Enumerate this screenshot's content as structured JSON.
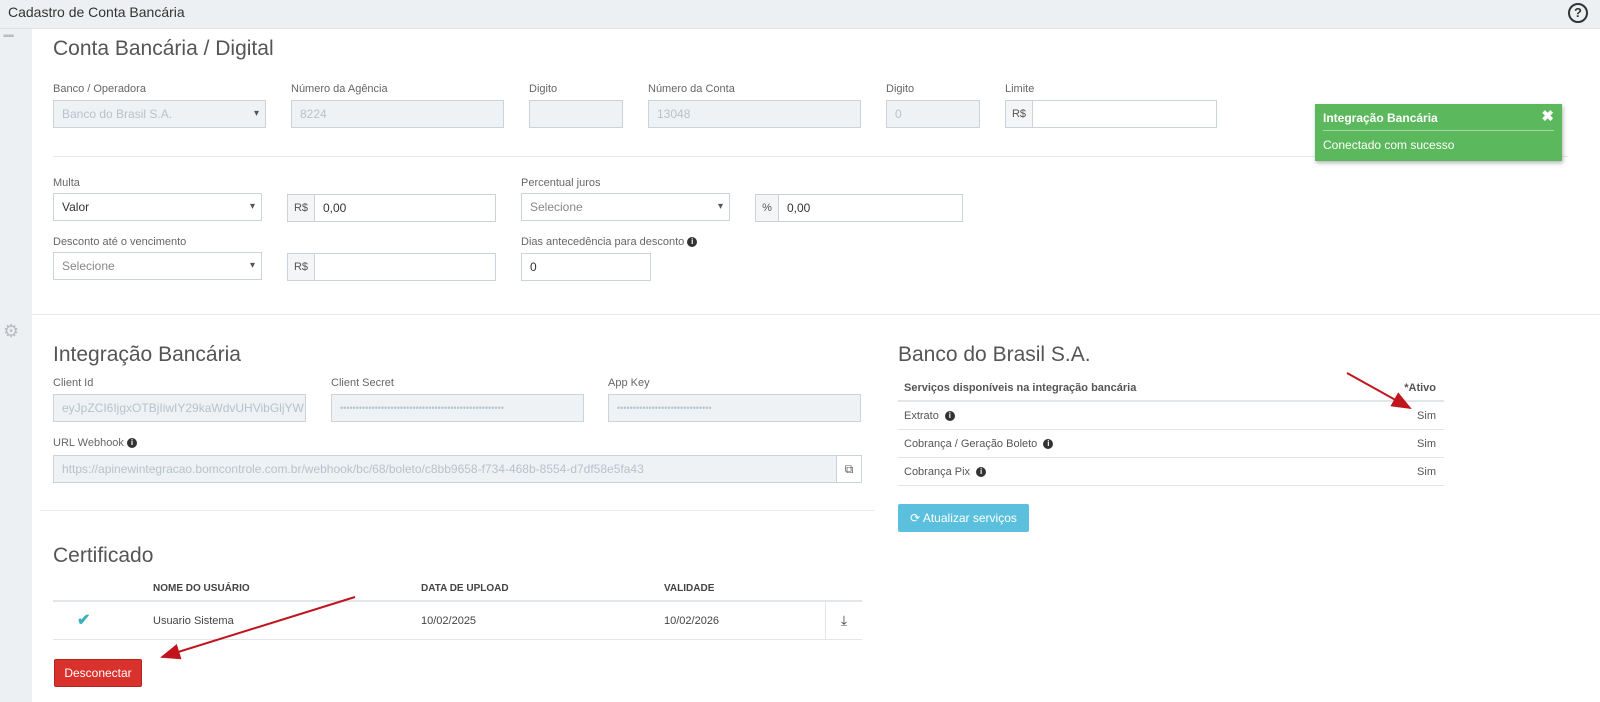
{
  "window": {
    "title": "Cadastro de Conta Bancária",
    "help_icon": "question-circle-icon"
  },
  "conta": {
    "title": "Conta Bancária / Digital",
    "banco_label": "Banco / Operadora",
    "banco_value": "Banco do Brasil S.A.",
    "agencia_label": "Número da Agência",
    "agencia_value": "8224",
    "digito_label": "Digito",
    "digito_agencia_value": "",
    "conta_label": "Número da Conta",
    "conta_value": "13048",
    "digito_conta_label": "Digito",
    "digito_conta_value": "0",
    "limite_label": "Limite",
    "limite_prefix": "R$",
    "limite_value": ""
  },
  "multa": {
    "label": "Multa",
    "tipo_value": "Valor",
    "prefix": "R$",
    "value": "0,00"
  },
  "juros": {
    "label": "Percentual juros",
    "tipo_value": "Selecione",
    "prefix": "%",
    "value": "0,00"
  },
  "desconto": {
    "label": "Desconto até o vencimento",
    "tipo_value": "Selecione",
    "prefix": "R$",
    "value": ""
  },
  "dias": {
    "label": "Dias antecedência para desconto",
    "value": "0"
  },
  "integracao": {
    "title": "Integração Bancária",
    "client_id_label": "Client Id",
    "client_id_value": "eyJpZCI6IjgxOTBjIiwIY29kaWdvUHVibGljYWI",
    "client_secret_label": "Client Secret",
    "client_secret_value": "••••••••••••••••••••••••••••••••••••••••••••••••••••",
    "app_key_label": "App Key",
    "app_key_value": "••••••••••••••••••••••••••••••",
    "webhook_label": "URL Webhook",
    "webhook_value": "https://apinewintegracao.bomcontrole.com.br/webhook/bc/68/boleto/c8bb9658-f734-468b-8554-d7df58e5fa43"
  },
  "banco_servicos": {
    "title": "Banco do Brasil S.A.",
    "header_service": "Serviços disponíveis na integração bancária",
    "header_active": "*Ativo",
    "rows": [
      {
        "name": "Extrato",
        "active": "Sim"
      },
      {
        "name": "Cobrança / Geração Boleto",
        "active": "Sim"
      },
      {
        "name": "Cobrança Pix",
        "active": "Sim"
      }
    ],
    "button": "Atualizar serviços"
  },
  "certificado": {
    "title": "Certificado",
    "col_user": "NOME DO USUÁRIO",
    "col_upload": "DATA DE UPLOAD",
    "col_validade": "VALIDADE",
    "row": {
      "user": "Usuario Sistema",
      "upload": "10/02/2025",
      "validade": "10/02/2026"
    },
    "disconnect": "Desconectar"
  },
  "toast": {
    "title": "Integração Bancária",
    "message": "Conectado com sucesso"
  },
  "colors": {
    "success": "#5cb85c",
    "info_button": "#5bc0de",
    "danger": "#d9312b",
    "arrow": "#c0151c"
  }
}
